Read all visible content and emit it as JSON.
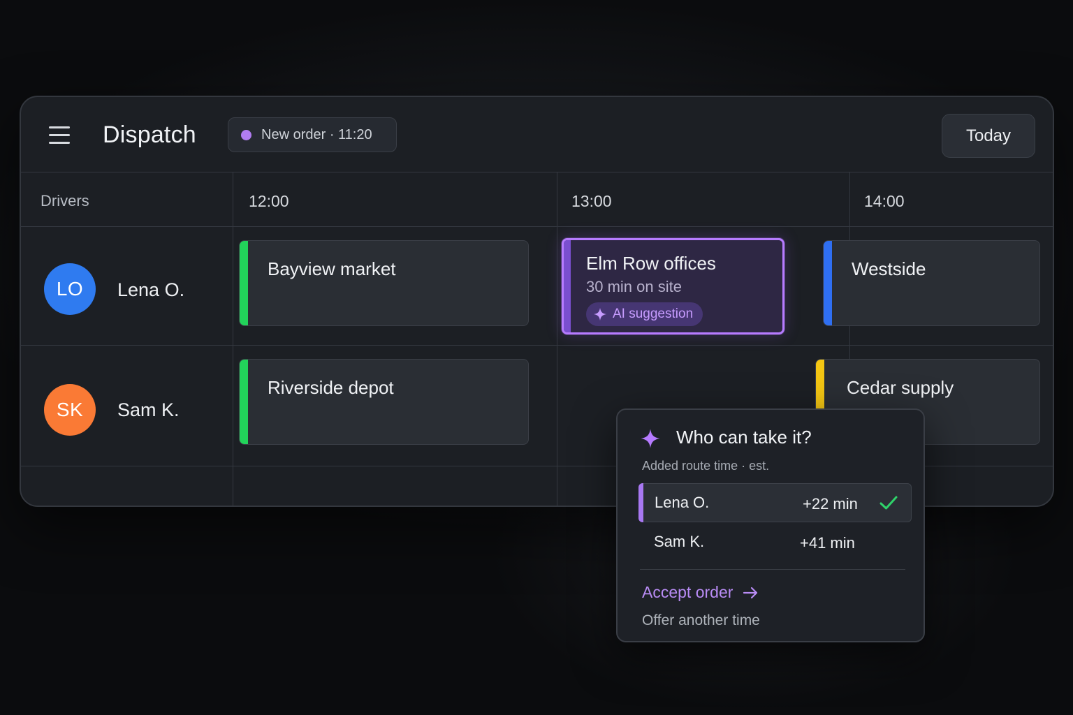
{
  "header": {
    "title": "Dispatch",
    "new_order_label": "New order · 11:20",
    "today_label": "Today"
  },
  "columns": {
    "drivers_label": "Drivers",
    "times": [
      "12:00",
      "13:00",
      "14:00"
    ]
  },
  "drivers": [
    {
      "initials": "LO",
      "name": "Lena O.",
      "avatar_color": "#2f7bf0"
    },
    {
      "initials": "SK",
      "name": "Sam K.",
      "avatar_color": "#fa7a35"
    }
  ],
  "jobs": {
    "lena": [
      {
        "title": "Bayview market",
        "color": "#22d35a"
      },
      {
        "title": "Elm Row offices",
        "subtitle": "30 min on site",
        "badge": "AI suggestion",
        "color": "#b67bff"
      },
      {
        "title": "Westside",
        "color": "#2f6ff2"
      }
    ],
    "sam": [
      {
        "title": "Riverside depot",
        "color": "#22d35a"
      },
      {
        "title": "Cedar supply",
        "color": "#f4c613"
      }
    ]
  },
  "popover": {
    "title": "Who can take it?",
    "subtitle": "Added route time · est.",
    "candidates": [
      {
        "name": "Lena O.",
        "added": "+22 min",
        "selected": true
      },
      {
        "name": "Sam K.",
        "added": "+41 min",
        "selected": false
      }
    ],
    "accept_label": "Accept order",
    "offer_label": "Offer another time"
  },
  "colors": {
    "accent": "#b67bff",
    "check": "#2fd36a",
    "order_dot": "#b07cf0"
  },
  "icons": [
    "menu-icon",
    "status-dot-icon",
    "sparkle-icon",
    "check-icon",
    "arrow-right-icon"
  ]
}
